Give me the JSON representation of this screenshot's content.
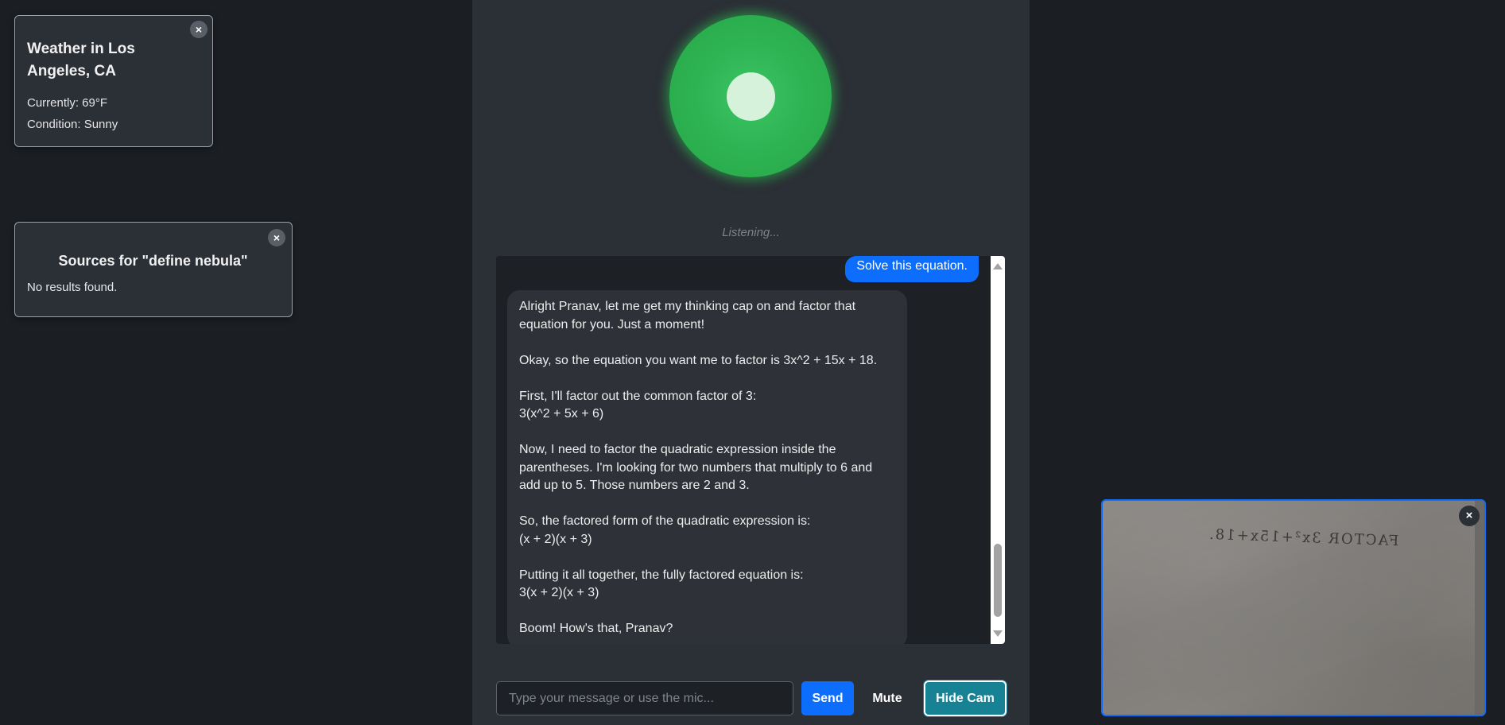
{
  "weather_widget": {
    "close": "×",
    "title": "Weather in Los Angeles, CA",
    "currently": "Currently: 69°F",
    "condition": "Condition: Sunny"
  },
  "sources_widget": {
    "close": "×",
    "title": "Sources for \"define nebula\"",
    "empty": "No results found."
  },
  "status": {
    "listening": "Listening..."
  },
  "chat": {
    "user_message": "Solve this equation.",
    "bot_message": "Alright Pranav, let me get my thinking cap on and factor that equation for you. Just a moment!\n\nOkay, so the equation you want me to factor is 3x^2 + 15x + 18.\n\nFirst, I'll factor out the common factor of 3:\n3(x^2 + 5x + 6)\n\nNow, I need to factor the quadratic expression inside the parentheses. I'm looking for two numbers that multiply to 6 and add up to 5. Those numbers are 2 and 3.\n\nSo, the factored form of the quadratic expression is:\n(x + 2)(x + 3)\n\nPutting it all together, the fully factored equation is:\n3(x + 2)(x + 3)\n\nBoom! How's that, Pranav?"
  },
  "input": {
    "value": "",
    "placeholder": "Type your message or use the mic..."
  },
  "buttons": {
    "send": "Send",
    "mute": "Mute",
    "hide_cam": "Hide Cam"
  },
  "camera": {
    "close": "×",
    "handwritten_text": "FACTOR 3x²+15x+18."
  },
  "colors": {
    "background": "#1b1e23",
    "panel": "#2b2f36",
    "accent_blue": "#0d6efd",
    "orb_green": "#2fb454",
    "hide_cam_teal": "#178294"
  }
}
